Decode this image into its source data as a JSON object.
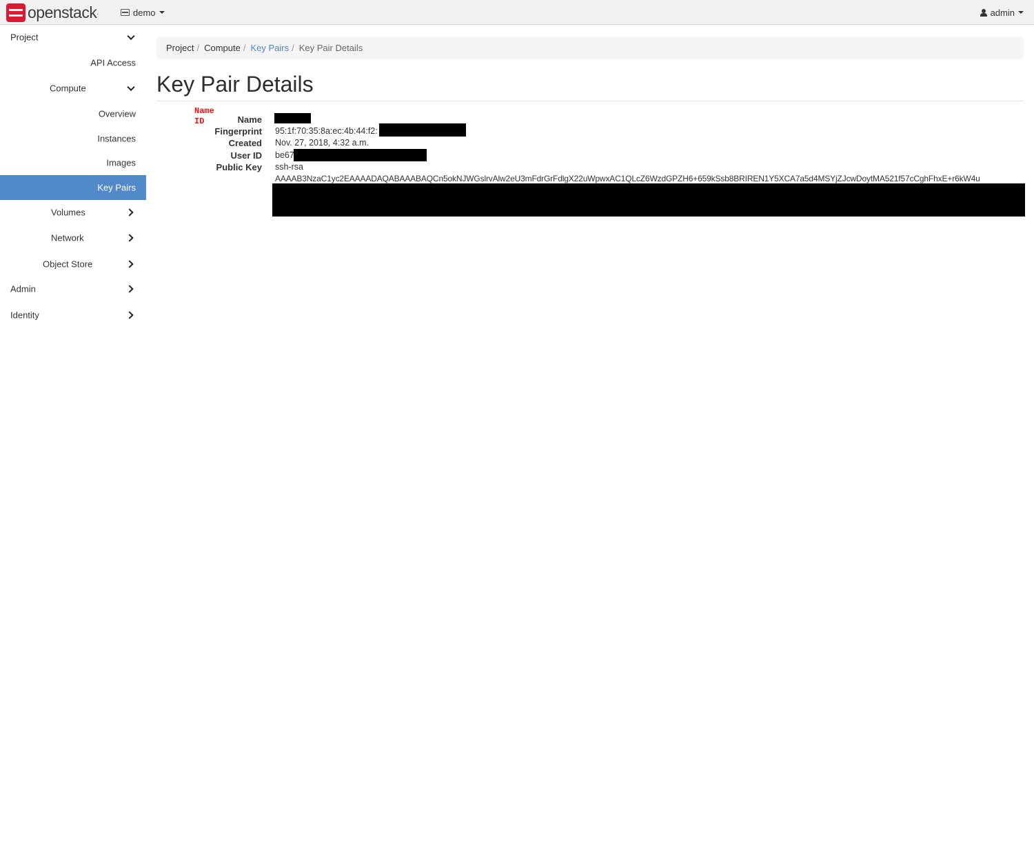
{
  "brand": {
    "name": "openstack",
    "dot": "."
  },
  "topbar": {
    "project": "demo",
    "user": "admin"
  },
  "sidebar": {
    "items": [
      {
        "label": "Project"
      },
      {
        "label": "API Access"
      },
      {
        "label": "Compute"
      },
      {
        "label": "Overview"
      },
      {
        "label": "Instances"
      },
      {
        "label": "Images"
      },
      {
        "label": "Key Pairs"
      },
      {
        "label": "Volumes"
      },
      {
        "label": "Network"
      },
      {
        "label": "Object Store"
      },
      {
        "label": "Admin"
      },
      {
        "label": "Identity"
      }
    ]
  },
  "breadcrumb": {
    "items": [
      "Project",
      "Compute",
      "Key Pairs",
      "Key Pair Details"
    ],
    "separator": "/"
  },
  "page": {
    "title": "Key Pair Details"
  },
  "annotation": {
    "line1": "Name",
    "line2": "ID"
  },
  "details": {
    "name_label": "Name",
    "fingerprint_label": "Fingerprint",
    "fingerprint_value": "95:1f:70:35:8a:ec:4b:44:f2:",
    "created_label": "Created",
    "created_value": "Nov. 27, 2018, 4:32 a.m.",
    "user_id_label": "User ID",
    "user_id_value": "be67",
    "public_key_label": "Public Key",
    "public_key_type": "ssh-rsa",
    "public_key_value": "AAAAB3NzaC1yc2EAAAADAQABAAABAQCn5okNJWGslrvAlw2eU3mFdrGrFdlgX22uWpwxAC1QLcZ6WzdGPZH6+659kSsb8BRIREN1Y5XCA7a5d4MSYjZJcwDoytMA521f57cCghFhxE+r6kW4u"
  },
  "colors": {
    "accent": "#5189c9",
    "link": "#4a88c8",
    "brand_red": "#da1a32",
    "annotation_red": "#ee1111"
  }
}
